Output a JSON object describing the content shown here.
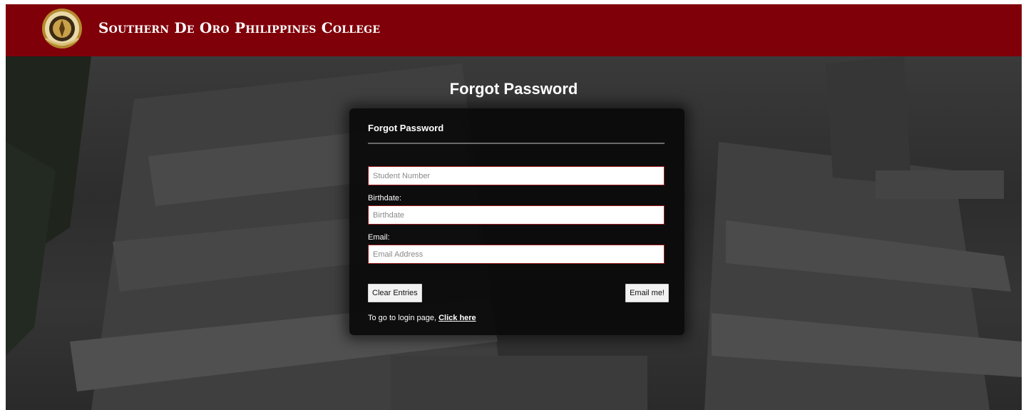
{
  "header": {
    "brand_name": "Southern De Oro Philippines College",
    "logo_icon": "college-seal-icon",
    "background_color": "#800009"
  },
  "page": {
    "title": "Forgot Password"
  },
  "card": {
    "title": "Forgot Password",
    "fields": {
      "student_number": {
        "label": "",
        "placeholder": "Student Number",
        "value": ""
      },
      "birthdate": {
        "label": "Birthdate:",
        "placeholder": "Birthdate",
        "value": ""
      },
      "email": {
        "label": "Email:",
        "placeholder": "Email Address",
        "value": ""
      }
    },
    "buttons": {
      "clear": "Clear Entries",
      "submit": "Email me!"
    },
    "login_prompt": "To go to login page,",
    "login_link": "Click here"
  }
}
